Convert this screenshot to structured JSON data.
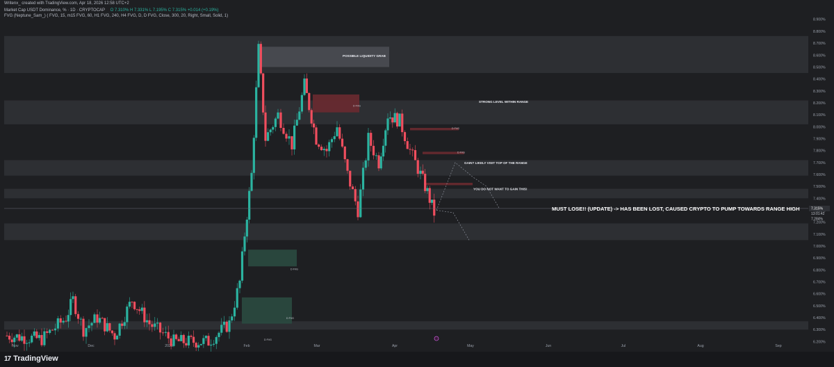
{
  "header": {
    "line1": "Writenx_ created with TradingView.com, Apr 18, 2026 12:58 UTC+2",
    "line2_title": "Market Cap USDT Dominance, % · 1D · CRYPTOCAP",
    "line2_ohlc": "O 7.310%  H 7.331%  L 7.195%  C 7.315%  +0.014 (+0.19%)",
    "line3": "FVG (Neptune_Sam_) ( FVG, 15, m15 FVG, 60, H1 FVG, 240, H4 FVG, D, D FVG, Close, 300, 20, Right, Small, Solid, 1)"
  },
  "branding": {
    "logo": "TradingView"
  },
  "annotations": {
    "liquidity_grab": "POSSIBLE LIQUIDITY GRAB",
    "strong_level": "STRONG LEVEL WITHIN RANGE",
    "gain_likely": "GAIN? LIKELY VISIT TOP OF THE RANGE",
    "dont_gain": "YOU DO NOT WANT TO GAIN THIS!",
    "must_lose": "MUST LOSE!! (UPDATE) -> HAS BEEN LOST, CAUSED CRYPTO TO PUMP TOWARDS RANGE HIGH",
    "fvg_label": "D FVG"
  },
  "price_tags": {
    "last": "7.315%",
    "countdown": "13:01:42",
    "other": "7.284%"
  },
  "colors": {
    "background": "#1e1f22",
    "up": "#2bb3a0",
    "down": "#f04e5e",
    "zone": "#3a3c42",
    "fvg_green": "#2a4a40",
    "fvg_red": "#6a2a30"
  },
  "chart_data": {
    "type": "candlestick",
    "title": "Market Cap USDT Dominance, % · 1D · CRYPTOCAP",
    "x_ticks": [
      "Nov",
      "Dec",
      "2026",
      "Feb",
      "Mar",
      "Apr",
      "May",
      "Jun",
      "Jul",
      "Aug",
      "Sep"
    ],
    "y_ticks": [
      "8.900%",
      "8.800%",
      "8.700%",
      "8.600%",
      "8.500%",
      "8.400%",
      "8.300%",
      "8.200%",
      "8.100%",
      "8.000%",
      "7.900%",
      "7.800%",
      "7.700%",
      "7.600%",
      "7.500%",
      "7.400%",
      "7.300%",
      "7.200%",
      "7.100%",
      "7.000%",
      "6.900%",
      "6.800%",
      "6.700%",
      "6.600%",
      "6.500%",
      "6.400%",
      "6.300%",
      "6.200%"
    ],
    "ylim": [
      6.15,
      8.98
    ],
    "zones": [
      {
        "y0": 8.76,
        "y1": 8.45
      },
      {
        "y0": 8.22,
        "y1": 8.02
      },
      {
        "y0": 7.72,
        "y1": 7.59
      },
      {
        "y0": 7.48,
        "y1": 7.4
      },
      {
        "y0": 7.19,
        "y1": 7.05
      },
      {
        "y0": 6.37,
        "y1": 6.3
      }
    ],
    "candles_summary": [
      {
        "period": "Nov",
        "range": [
          6.2,
          6.6
        ]
      },
      {
        "period": "Dec",
        "range": [
          6.2,
          6.55
        ]
      },
      {
        "period": "Jan",
        "range": [
          6.15,
          6.5
        ]
      },
      {
        "period": "Feb",
        "range": [
          6.25,
          8.65
        ]
      },
      {
        "period": "Mar",
        "range": [
          7.6,
          8.25
        ]
      },
      {
        "period": "Apr",
        "range": [
          7.2,
          8.15
        ]
      }
    ],
    "last_price": 7.315
  }
}
